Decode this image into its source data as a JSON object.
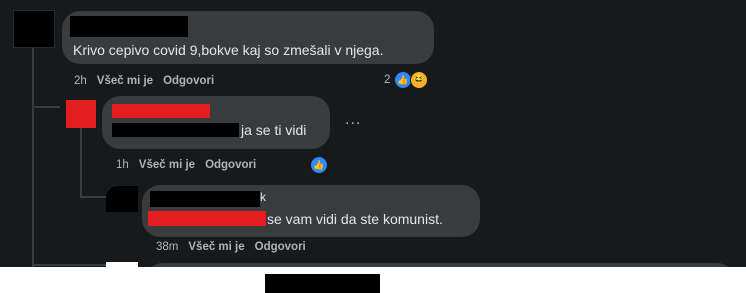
{
  "comments": [
    {
      "text": "Krivo cepivo covid 9,bokve kaj so zmešali v njega.",
      "time": "2h",
      "like_label": "Všeč mi je",
      "reply_label": "Odgovori",
      "reaction_count": "2",
      "reactions": [
        "like-icon",
        "haha-icon"
      ]
    },
    {
      "text": "ja se ti vidi",
      "time": "1h",
      "like_label": "Všeč mi je",
      "reply_label": "Odgovori",
      "more_label": "...",
      "reactions": [
        "like-icon"
      ]
    },
    {
      "author_fragment": "k",
      "text": "se vam vidi da ste komunist.",
      "time": "38m",
      "like_label": "Všeč mi je",
      "reply_label": "Odgovori"
    }
  ],
  "colors": {
    "background": "#18191a",
    "bubble": "#3a3b3c",
    "text": "#e4e6eb",
    "meta": "#b0b3b8",
    "like_blue": "#2e89ff",
    "redaction_red": "#e41e1e",
    "redaction_black": "#000000"
  }
}
